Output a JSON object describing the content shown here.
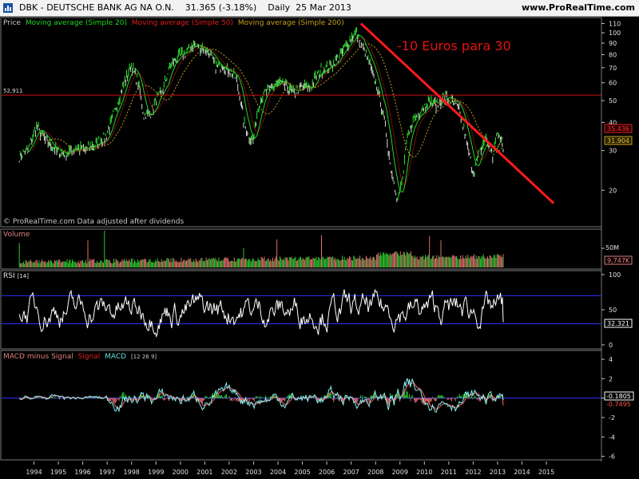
{
  "header": {
    "title": "DBK - DEUTSCHE BANK AG NA O.N.    31.365 (-3.18%)    Daily  25 Mar 2013",
    "site": "www.ProRealTime.com"
  },
  "price_panel": {
    "legend": [
      {
        "text": "Price",
        "color": "#c8c8c8"
      },
      {
        "text": "Moving average (Simple 20)",
        "color": "#22d822"
      },
      {
        "text": "Moving average (Simple 50)",
        "color": "#e02020"
      },
      {
        "text": "Moving average (Simple 200)",
        "color": "#c8a020"
      }
    ],
    "watermark": "© ProRealTime.com  Data adjusted after dividends",
    "annotation": "-10 Euros para 30",
    "hline_label": "52,911",
    "badge_red": "35.436",
    "badge_yellow": "31.904"
  },
  "volume_panel": {
    "title": "Volume",
    "unit_tick": "50M",
    "badge": "9,747K"
  },
  "rsi_panel": {
    "title": "RSI",
    "param": "[14]",
    "badge": "32.321"
  },
  "macd_panel": {
    "titles": [
      {
        "text": "MACD minus Signal",
        "color": "#e08080"
      },
      {
        "text": "Signal",
        "color": "#e02020"
      },
      {
        "text": "MACD",
        "color": "#60e0e0"
      },
      {
        "text": "[12 26 9]",
        "color": "#c8c8c8"
      }
    ],
    "badge_a": "-0.1805",
    "badge_b": "-0.7495"
  },
  "colors": {
    "price": "#22b822",
    "ma20": "#22d822",
    "ma50": "#e02020",
    "ma200": "#c8a020",
    "trendline": "#ff1a1a",
    "hline": "#d01010",
    "rsi_band": "#3030ff",
    "macd": "#80f0f0",
    "signal": "#ff6060"
  },
  "chart_data": [
    {
      "type": "line",
      "title": "Price",
      "x_ticks": [
        "1994",
        "1995",
        "1996",
        "1997",
        "1998",
        "1999",
        "2000",
        "2001",
        "2002",
        "2003",
        "2004",
        "2005",
        "2006",
        "2007",
        "2008",
        "2009",
        "2010",
        "2011",
        "2012",
        "2013",
        "2014",
        "2015"
      ],
      "y_ticks": [
        20,
        30,
        40,
        50,
        60,
        70,
        80,
        90,
        100,
        110
      ],
      "log_scale": true,
      "ylim": [
        14,
        115
      ],
      "x": [
        1993.4,
        1993.8,
        1994.1,
        1994.5,
        1994.9,
        1995.3,
        1995.7,
        1996.1,
        1996.5,
        1996.9,
        1997.1,
        1997.4,
        1997.7,
        1998.0,
        1998.3,
        1998.5,
        1998.8,
        1999.0,
        1999.3,
        1999.6,
        1999.9,
        2000.2,
        2000.5,
        2000.8,
        2001.0,
        2001.2,
        2001.5,
        2001.7,
        2002.0,
        2002.3,
        2002.6,
        2002.8,
        2003.0,
        2003.2,
        2003.5,
        2003.8,
        2004.1,
        2004.4,
        2004.7,
        2005.0,
        2005.3,
        2005.6,
        2005.9,
        2006.2,
        2006.5,
        2006.8,
        2007.0,
        2007.2,
        2007.4,
        2007.6,
        2007.8,
        2008.0,
        2008.3,
        2008.6,
        2008.9,
        2009.1,
        2009.3,
        2009.6,
        2009.9,
        2010.2,
        2010.5,
        2010.8,
        2011.1,
        2011.4,
        2011.6,
        2011.8,
        2012.0,
        2012.3,
        2012.5,
        2012.8,
        2013.0,
        2013.23
      ],
      "values": [
        28,
        31,
        38,
        33,
        30,
        29,
        31,
        30,
        32,
        34,
        38,
        48,
        60,
        72,
        58,
        43,
        44,
        50,
        56,
        72,
        78,
        82,
        88,
        87,
        85,
        80,
        70,
        72,
        68,
        62,
        40,
        35,
        33,
        48,
        55,
        58,
        60,
        57,
        54,
        58,
        56,
        65,
        70,
        72,
        78,
        88,
        95,
        100,
        90,
        80,
        70,
        60,
        44,
        26,
        18,
        22,
        34,
        42,
        46,
        50,
        48,
        52,
        50,
        46,
        38,
        30,
        24,
        30,
        34,
        28,
        36,
        31.4
      ],
      "hline": 52.911,
      "trendline": [
        [
          2007.4,
          110
        ],
        [
          2015.3,
          17.5
        ]
      ]
    },
    {
      "type": "bar",
      "title": "Volume",
      "y_ticks": [
        "50M"
      ],
      "last": "9,747K"
    },
    {
      "type": "line",
      "title": "RSI [14]",
      "y_ticks": [
        0,
        50,
        100
      ],
      "ylim": [
        0,
        100
      ],
      "bands": [
        30,
        70
      ],
      "last": 32.321
    },
    {
      "type": "line",
      "title": "MACD [12 26 9]",
      "y_ticks": [
        -6,
        -4,
        -2,
        0,
        2,
        4
      ],
      "ylim": [
        -6.2,
        4.5
      ],
      "last_macd": -0.1805,
      "last_signal": -0.7495
    }
  ]
}
